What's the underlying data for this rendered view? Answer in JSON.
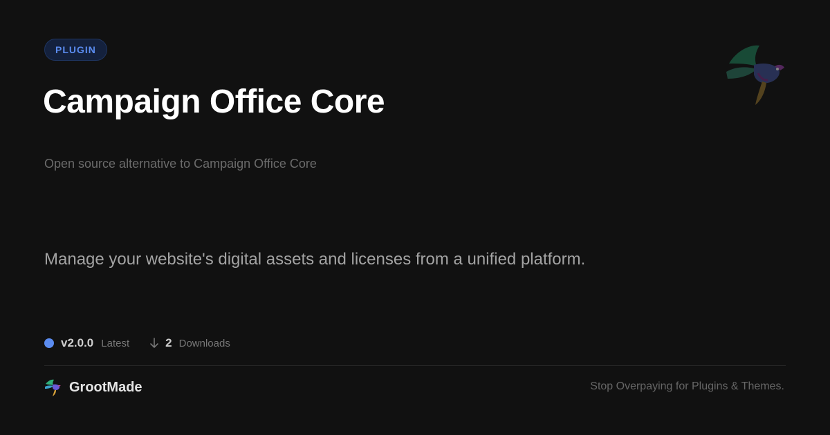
{
  "badge": {
    "label": "PLUGIN"
  },
  "plugin": {
    "title": "Campaign Office Core",
    "subtitle": "Open source alternative  to Campaign Office Core",
    "description": "Manage your website's digital assets and licenses from a unified platform."
  },
  "meta": {
    "version": "v2.0.0",
    "version_status": "Latest",
    "downloads_count": "2",
    "downloads_label": "Downloads"
  },
  "footer": {
    "brand_name": "GrootMade",
    "tagline": "Stop Overpaying  for Plugins & Themes."
  },
  "icons": {
    "download": "arrow-down-icon",
    "brand_logo": "hummingbird-logo-icon",
    "decorative": "hummingbird-icon"
  },
  "colors": {
    "background": "#111111",
    "accent": "#5b8cf0",
    "title": "#ffffff"
  }
}
